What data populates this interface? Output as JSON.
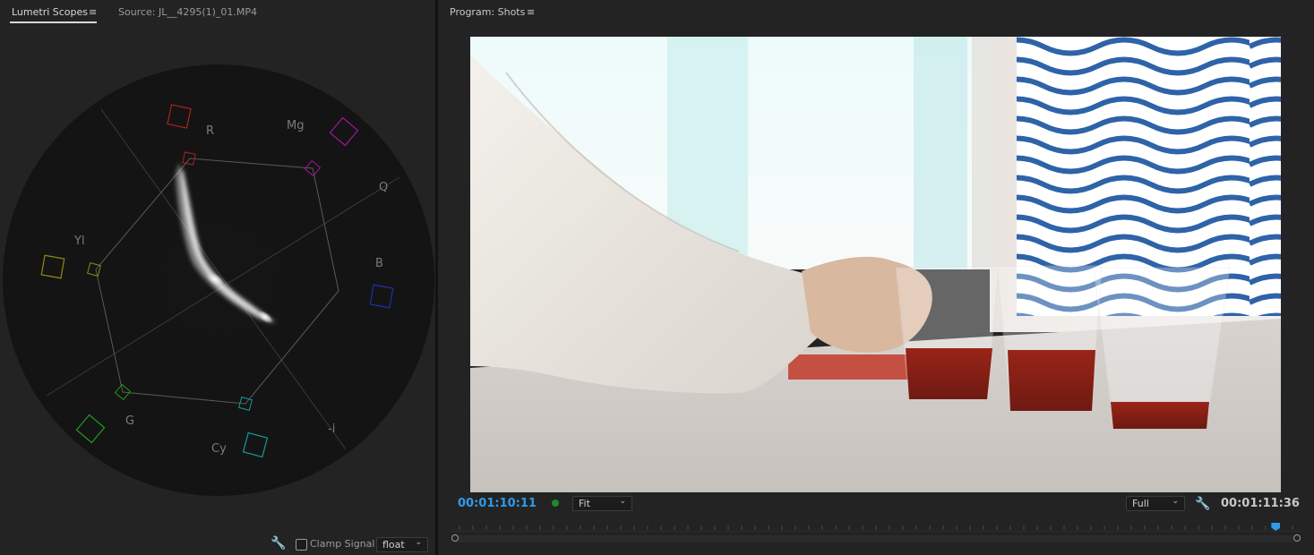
{
  "scopes_panel": {
    "tab_active": "Lumetri Scopes",
    "tab_source": "Source: JL__4295(1)_01.MP4",
    "labels": {
      "r": "R",
      "mg": "Mg",
      "q": "Q",
      "b": "B",
      "yl": "Yl",
      "g": "G",
      "cy": "Cy",
      "neg_i": "-i"
    },
    "footer": {
      "clamp_signal_label": "Clamp Signal",
      "clamp_signal_checked": false,
      "bit_depth_value": "float"
    }
  },
  "program_panel": {
    "title": "Program: Shots",
    "current_timecode": "00:01:10:11",
    "total_timecode": "00:01:11:36",
    "zoom_value": "Fit",
    "resolution_value": "Full",
    "playhead_position": 0.98
  },
  "colors": {
    "accent_blue": "#2f9bea",
    "panel_bg": "#232323",
    "red_target": "#b4201f",
    "magenta_target": "#a0189c",
    "blue_target": "#1f2fa8",
    "cyan_target": "#139c9c",
    "green_target": "#1d9d1d",
    "yellow_target": "#8e8a15"
  }
}
